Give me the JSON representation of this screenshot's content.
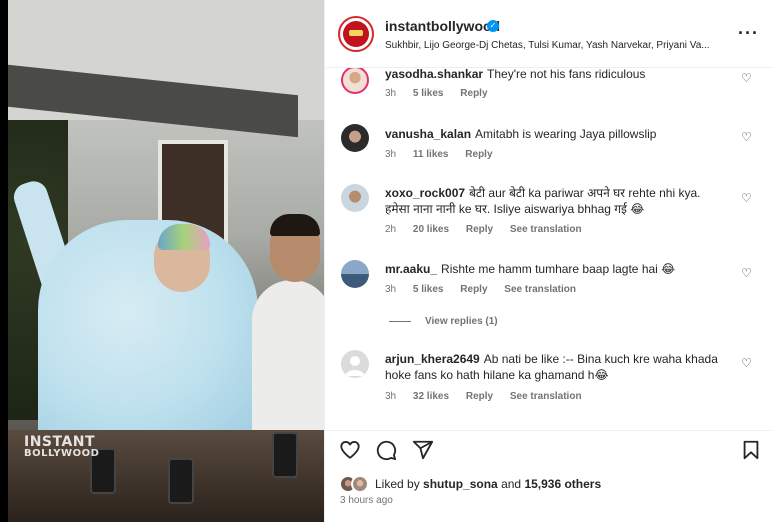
{
  "post": {
    "username": "instantbollywood",
    "collaborators": "Sukhbir, Lijo George-Dj Chetas, Tulsi Kumar, Yash Narvekar, Priyani Va...",
    "watermark_line1": "INSTANT",
    "watermark_line2": "BOLLYWOOD"
  },
  "comments": [
    {
      "user": "yasodha.shankar",
      "text": "They're not his fans ridiculous",
      "time": "3h",
      "likes": "5 likes",
      "reply": "Reply",
      "translation": ""
    },
    {
      "user": "vanusha_kalan",
      "text": "Amitabh is wearing Jaya pillowslip",
      "time": "3h",
      "likes": "11 likes",
      "reply": "Reply",
      "translation": ""
    },
    {
      "user": "xoxo_rock007",
      "text": "बेटी aur बेटी ka pariwar अपने घर rehte nhi kya. हमेसा नाना नानी ke घर. Isliye aiswariya bhhag गई 😂",
      "time": "2h",
      "likes": "20 likes",
      "reply": "Reply",
      "translation": "See translation"
    },
    {
      "user": "mr.aaku_",
      "text": "Rishte me hamm tumhare baap lagte hai 😂",
      "time": "3h",
      "likes": "5 likes",
      "reply": "Reply",
      "translation": "See translation"
    },
    {
      "user": "arjun_khera2649",
      "text": "Ab nati be like :-- Bina kuch kre waha khada hoke fans ko hath hilane ka ghamand h😂",
      "time": "3h",
      "likes": "32 likes",
      "reply": "Reply",
      "translation": "See translation"
    }
  ],
  "view_replies": "View replies (1)",
  "likes_summary": {
    "prefix": "Liked by",
    "user": "shutup_sona",
    "middle": "and",
    "count": "15,936 others"
  },
  "time_ago": "3 hours ago",
  "icons": {
    "like": "heart-icon",
    "comment": "comment-bubble-icon",
    "share": "paper-plane-icon",
    "save": "bookmark-icon",
    "more": "more-options-icon"
  },
  "colors": {
    "verified": "#0095f6",
    "text": "#262626",
    "secondary": "#737373"
  }
}
